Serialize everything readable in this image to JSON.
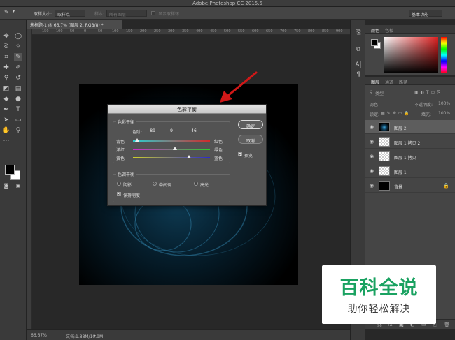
{
  "app": {
    "title": "Adobe Photoshop CC 2015.5"
  },
  "options_bar": {
    "sample_size_label": "取样大小:",
    "sample_size_value": "取样点",
    "sample_label": "样本:",
    "sample_value": "所有图层",
    "show_ring_label": "显示取样环",
    "workspace": "基本功能"
  },
  "document": {
    "tab_title": "未标题-1 @ 66.7% (图层 2, RGB/8) *",
    "ruler_marks": [
      "150",
      "100",
      "50",
      "0",
      "50",
      "100",
      "150",
      "200",
      "250",
      "300",
      "350",
      "400",
      "450",
      "500",
      "550",
      "600",
      "650",
      "700",
      "750",
      "800",
      "850",
      "900"
    ]
  },
  "status": {
    "zoom": "66.67%",
    "doc_info": "文档:1.88M/10.9M"
  },
  "panels": {
    "color_tab": "颜色",
    "swatches_tab": "色板",
    "layers_tab": "图层",
    "channels_tab": "通道",
    "paths_tab": "路径",
    "kind_filter": "类型",
    "blend_mode": "滤色",
    "opacity_label": "不透明度:",
    "opacity_value": "100%",
    "lock_label": "锁定:",
    "fill_label": "填充:",
    "fill_value": "100%"
  },
  "layers": [
    {
      "name": "图层 2",
      "thumb": "glow",
      "selected": true
    },
    {
      "name": "图层 1 拷贝 2",
      "thumb": "checker",
      "selected": false
    },
    {
      "name": "图层 1 拷贝",
      "thumb": "checker",
      "selected": false
    },
    {
      "name": "图层 1",
      "thumb": "checker",
      "selected": false
    },
    {
      "name": "背景",
      "thumb": "black",
      "selected": false,
      "locked": true
    }
  ],
  "dialog": {
    "title": "色彩平衡",
    "balance_group": "色彩平衡",
    "levels_label": "色阶:",
    "levels": [
      "-89",
      "9",
      "46"
    ],
    "levels_fraction": [
      0.055,
      0.545,
      0.73
    ],
    "cyan": "青色",
    "red": "红色",
    "magenta": "洋红",
    "green": "绿色",
    "yellow": "黄色",
    "blue": "蓝色",
    "ok": "确定",
    "cancel": "取消",
    "preview": "预览",
    "tone_group": "色调平衡",
    "shadows": "阴影",
    "midtones": "中间调",
    "highlights": "高光",
    "preserve_luminosity": "保持明度"
  },
  "watermark": {
    "title": "百科全说",
    "subtitle": "助你轻松解决"
  },
  "colors": {
    "accent_green": "#1aa261",
    "arrow_red": "#d01818"
  }
}
